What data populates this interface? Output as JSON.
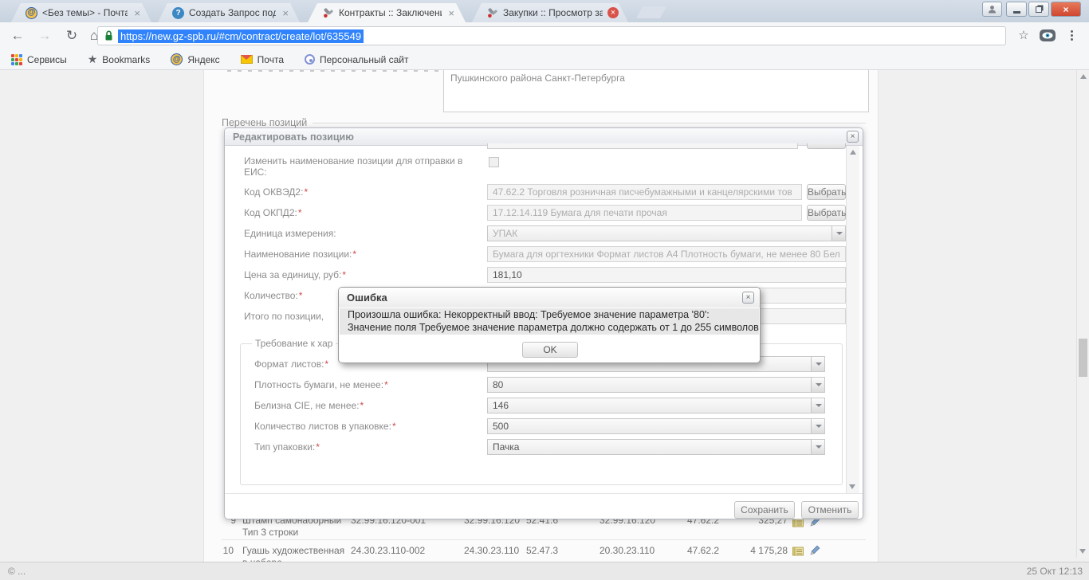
{
  "glyphs": {
    "at": "@",
    "help": "?",
    "back": "←",
    "forward": "→",
    "reload": "↻",
    "home": "⌂",
    "star_outline": "☆",
    "star_filled": "★",
    "menu": "⋮",
    "close": "×"
  },
  "colors": {
    "selection_blue": "#3083fa",
    "lock_green": "#1a7f37",
    "required_red": "#cc4b4b",
    "close_red": "#d9534a",
    "tabbar": "#ccd7e3"
  },
  "browser": {
    "tabs": [
      {
        "label": "<Без темы> - Почта Ма",
        "icon": "mailru-icon",
        "close": "×"
      },
      {
        "label": "Создать Запрос поддер",
        "icon": "help-icon",
        "close": "×"
      },
      {
        "label": "Контракты :: Заключени",
        "icon": "gavel-icon",
        "close": "×"
      },
      {
        "label": "Закупки :: Просмотр зак",
        "icon": "gavel-icon",
        "close": "×"
      }
    ],
    "toolbar": {
      "url": "https://new.gz-spb.ru/#cm/contract/create/lot/635549"
    },
    "bookmarks": [
      {
        "label": "Сервисы",
        "icon": "apps-grid-icon"
      },
      {
        "label": "Bookmarks",
        "icon": "star-icon"
      },
      {
        "label": "Яндекс",
        "icon": "mailru-icon"
      },
      {
        "label": "Почта",
        "icon": "envelope-icon"
      },
      {
        "label": "Персональный сайт",
        "icon": "site-icon"
      }
    ]
  },
  "page": {
    "address_text": "Пушкинского района Санкт-Петербурга",
    "positions_legend": "Перечень позиций",
    "status_left": "© ...",
    "status_right": "25 Окт 12:13"
  },
  "modal": {
    "title": "Редактировать позицию",
    "required_mark": "*",
    "fields": {
      "eis_label": "Изменить наименование позиции для отправки в ЕИС:",
      "okved_label": "Код ОКВЭД2:",
      "okved_value": "47.62.2 Торговля розничная писчебумажными и канцелярскими тов",
      "choose_button": "Выбрать",
      "okpd_label": "Код ОКПД2:",
      "okpd_value": "17.12.14.119 Бумага для печати прочая",
      "unit_label": "Единица измерения:",
      "unit_value": "УПАК",
      "name_label": "Наименование позиции:",
      "name_value": "Бумага для оргтехники Формат листов А4 Плотность бумаги, не менее 80 Бел",
      "price_label": "Цена за единицу, руб:",
      "price_value": "181,10",
      "qty_label": "Количество:",
      "qty_value": "",
      "total_label": "Итого по позиции,",
      "total_value": ""
    },
    "characteristics": {
      "legend": "Требование к хар",
      "format_label": "Формат листов:",
      "format_value": "",
      "density_label": "Плотность бумаги, не менее:",
      "density_value": "80",
      "whiteness_label": "Белизна CIE, не менее:",
      "whiteness_value": "146",
      "sheets_label": "Количество листов в упаковке:",
      "sheets_value": "500",
      "pack_label": "Тип упаковки:",
      "pack_value": "Пачка"
    },
    "save_button": "Сохранить",
    "cancel_button": "Отменить"
  },
  "error_dialog": {
    "title": "Ошибка",
    "message_line1": "Произошла ошибка: Некорректный ввод: Требуемое значение параметра '80':",
    "message_line2": "Значение поля Требуемое значение параметра должно содержать от 1 до 255 символов",
    "ok_button": "OK"
  },
  "table": {
    "rows": [
      {
        "num": "9",
        "name": "Штамп самонаборный",
        "name2": "Тип 3 строки",
        "code1": "32.99.16.120-001",
        "code2": "32.99.16.120",
        "code3": "52.41.6",
        "code4": "32.99.16.120",
        "code5": "47.62.2",
        "price": "325,27"
      },
      {
        "num": "10",
        "name": "Гуашь художественная",
        "name2": "в наборе",
        "code1": "24.30.23.110-002",
        "code2": "24.30.23.110",
        "code3": "52.47.3",
        "code4": "20.30.23.110",
        "code5": "47.62.2",
        "price": "4 175,28"
      }
    ]
  }
}
